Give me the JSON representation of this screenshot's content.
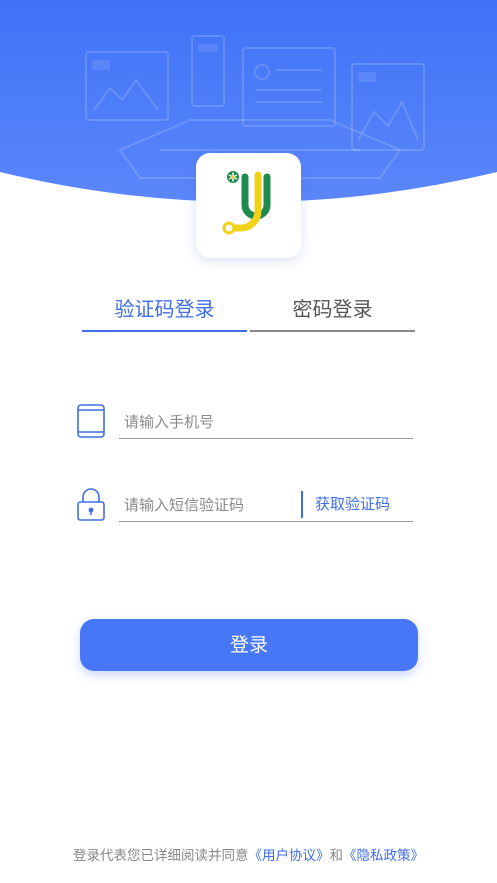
{
  "colors": {
    "accent": "#4777f6",
    "tab_active": "#3f6de8",
    "hero_bg": "#4a78f8",
    "logo_green": "#1f8a4e",
    "logo_yellow": "#f1d21b"
  },
  "header": {
    "logo_icon": "app-logo-icon"
  },
  "tabs": [
    {
      "label": "验证码登录",
      "active": true
    },
    {
      "label": "密码登录",
      "active": false
    }
  ],
  "phone": {
    "icon": "phone-icon",
    "value": "",
    "placeholder": "请输入手机号"
  },
  "sms_code": {
    "icon": "lock-icon",
    "value": "",
    "placeholder": "请输入短信验证码",
    "get_code_label": "获取验证码"
  },
  "login": {
    "label": "登录"
  },
  "agreement": {
    "prefix": "登录代表您已详细阅读并同意",
    "user_agreement": "《用户协议》",
    "conjunction": "和",
    "privacy_policy": "《隐私政策》"
  }
}
